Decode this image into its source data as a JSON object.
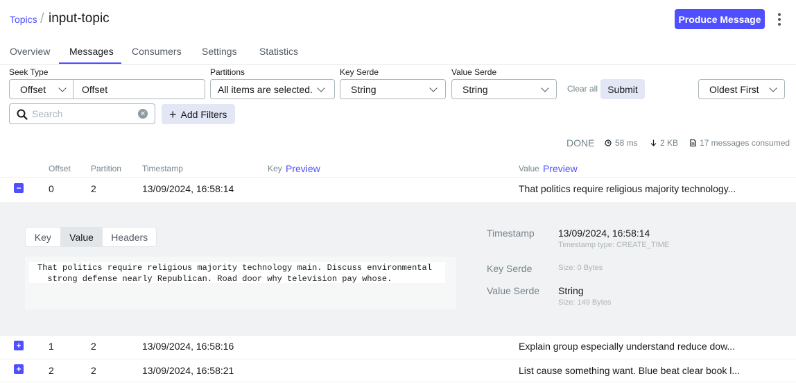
{
  "breadcrumb": {
    "parent": "Topics",
    "separator": "/",
    "current": "input-topic"
  },
  "header": {
    "produce_label": "Produce Message"
  },
  "tabs": [
    {
      "label": "Overview"
    },
    {
      "label": "Messages"
    },
    {
      "label": "Consumers"
    },
    {
      "label": "Settings"
    },
    {
      "label": "Statistics"
    }
  ],
  "filters": {
    "seek_type_label": "Seek Type",
    "seek_type_value": "Offset",
    "seek_value": "Offset",
    "partitions_label": "Partitions",
    "partitions_value": "All items are selected.",
    "key_serde_label": "Key Serde",
    "key_serde_value": "String",
    "value_serde_label": "Value Serde",
    "value_serde_value": "String",
    "clear_all": "Clear all",
    "submit": "Submit",
    "sort_value": "Oldest First",
    "search_placeholder": "Search",
    "add_filters": "Add Filters"
  },
  "status": {
    "state": "DONE",
    "elapsed": "58 ms",
    "size": "2 KB",
    "consumed": "17 messages consumed"
  },
  "table": {
    "headers": {
      "offset": "Offset",
      "partition": "Partition",
      "timestamp": "Timestamp",
      "key": "Key",
      "value": "Value",
      "preview": "Preview"
    },
    "rows": [
      {
        "toggle": "−",
        "offset": "0",
        "partition": "2",
        "timestamp": "13/09/2024, 16:58:14",
        "value": "That politics require religious majority technology..."
      },
      {
        "toggle": "+",
        "offset": "1",
        "partition": "2",
        "timestamp": "13/09/2024, 16:58:16",
        "value": "Explain group especially understand reduce dow..."
      },
      {
        "toggle": "+",
        "offset": "2",
        "partition": "2",
        "timestamp": "13/09/2024, 16:58:21",
        "value": "List cause something want. Blue beat clear book l..."
      }
    ]
  },
  "expanded": {
    "tabs": [
      "Key",
      "Value",
      "Headers"
    ],
    "active_tab": "Value",
    "content": "That politics require religious majority technology main. Discuss environmental\n  strong defense nearly Republican. Road door why television pay whose.",
    "timestamp_label": "Timestamp",
    "timestamp_value": "13/09/2024, 16:58:14",
    "timestamp_type": "Timestamp type: CREATE_TIME",
    "key_serde_label": "Key Serde",
    "key_serde_size": "Size: 0 Bytes",
    "value_serde_label": "Value Serde",
    "value_serde_value": "String",
    "value_serde_size": "Size: 149 Bytes"
  },
  "colors": {
    "accent": "#4f4fff",
    "expanded_bg": "#f1f2f3"
  }
}
